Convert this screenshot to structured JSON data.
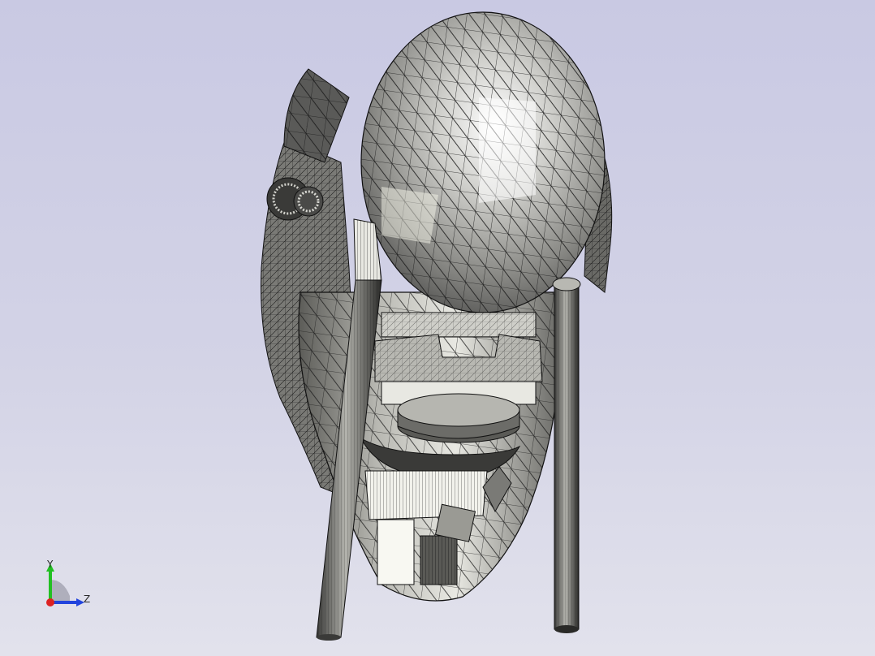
{
  "viewport": {
    "background_top": "#c9c9e3",
    "background_bottom": "#e2e2ec",
    "mesh_stroke": "#1a1a1a",
    "shade_light": "#f4f4ee",
    "shade_mid": "#a8a8a4",
    "shade_dark": "#4a4a48"
  },
  "model": {
    "icon": "robot-head-wireframe"
  },
  "triad": {
    "y_label": "Y",
    "z_label": "Z",
    "y_color": "#22c022",
    "z_color": "#2244dd",
    "x_color": "#dd2222"
  }
}
